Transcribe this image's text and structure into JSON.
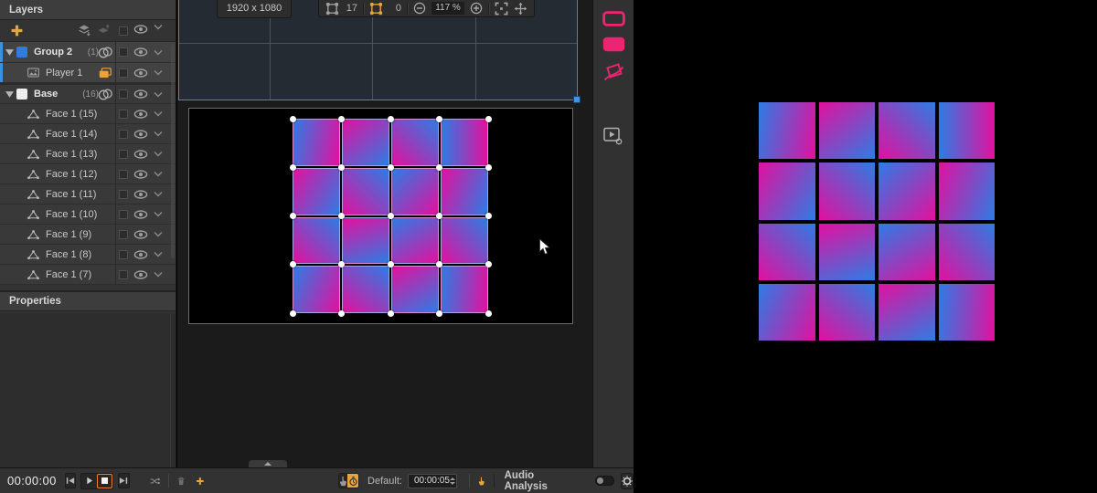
{
  "layers": {
    "title": "Layers",
    "rows": [
      {
        "type": "group",
        "name": "Group 2",
        "count": "(1)",
        "swatch": "#2e7cdb",
        "selected": true
      },
      {
        "type": "player",
        "name": "Player 1",
        "selected": true
      },
      {
        "type": "group",
        "name": "Base",
        "count": "(16)",
        "swatch": "#ededed",
        "gap_before": true
      },
      {
        "type": "face",
        "name": "Face 1 (15)"
      },
      {
        "type": "face",
        "name": "Face 1 (14)"
      },
      {
        "type": "face",
        "name": "Face 1 (13)"
      },
      {
        "type": "face",
        "name": "Face 1 (12)"
      },
      {
        "type": "face",
        "name": "Face 1 (11)"
      },
      {
        "type": "face",
        "name": "Face 1 (10)"
      },
      {
        "type": "face",
        "name": "Face 1 (9)"
      },
      {
        "type": "face",
        "name": "Face 1 (8)"
      },
      {
        "type": "face",
        "name": "Face 1 (7)"
      }
    ]
  },
  "properties": {
    "title": "Properties"
  },
  "canvas": {
    "resolution": "1920 x 1080",
    "warp_count_inactive": "17",
    "warp_count_active": "0",
    "zoom_level": "117 %",
    "toolbar_icons": [
      "perspective-warp-icon",
      "bezier-warp-icon",
      "zoom-out-icon",
      "zoom-in-icon",
      "fit-view-icon",
      "pan-icon"
    ]
  },
  "toolstrip_icons": [
    "draw-rectangle-outline-icon",
    "draw-rectangle-filled-icon",
    "draw-freehand-shape-icon",
    "output-settings-icon"
  ],
  "timeline": {
    "timecode": "00:00:00",
    "default_label": "Default:",
    "default_duration": "00:00:05",
    "audio_label": "Audio Analysis"
  },
  "colors": {
    "accent_orange": "#e8a33b",
    "accent_pink": "#ee2371",
    "accent_blue": "#3f94e8",
    "gradient_pink": "#e3109f",
    "gradient_blue": "#2d7ce4"
  },
  "mapping_grid": {
    "rows": 4,
    "cols": 4,
    "cells": [
      {
        "angle": 100,
        "from": "#2d7ce4",
        "to": "#e3109f"
      },
      {
        "angle": 140,
        "from": "#e3109f",
        "to": "#2d7ce4"
      },
      {
        "angle": 45,
        "from": "#e3109f",
        "to": "#2d7ce4"
      },
      {
        "angle": 90,
        "from": "#2d7ce4",
        "to": "#e3109f"
      },
      {
        "angle": 120,
        "from": "#e3109f",
        "to": "#2d7ce4"
      },
      {
        "angle": 45,
        "from": "#e3109f",
        "to": "#2d7ce4"
      },
      {
        "angle": 135,
        "from": "#2d7ce4",
        "to": "#e3109f"
      },
      {
        "angle": 110,
        "from": "#e3109f",
        "to": "#2d7ce4"
      },
      {
        "angle": 45,
        "from": "#e3109f",
        "to": "#2d7ce4"
      },
      {
        "angle": 160,
        "from": "#e3109f",
        "to": "#2d7ce4"
      },
      {
        "angle": 150,
        "from": "#2d7ce4",
        "to": "#e3109f"
      },
      {
        "angle": 50,
        "from": "#e3109f",
        "to": "#2d7ce4"
      },
      {
        "angle": 115,
        "from": "#2d7ce4",
        "to": "#e3109f"
      },
      {
        "angle": 40,
        "from": "#e3109f",
        "to": "#2d7ce4"
      },
      {
        "angle": 150,
        "from": "#e3109f",
        "to": "#2d7ce4"
      },
      {
        "angle": 95,
        "from": "#2d7ce4",
        "to": "#e3109f"
      }
    ]
  }
}
